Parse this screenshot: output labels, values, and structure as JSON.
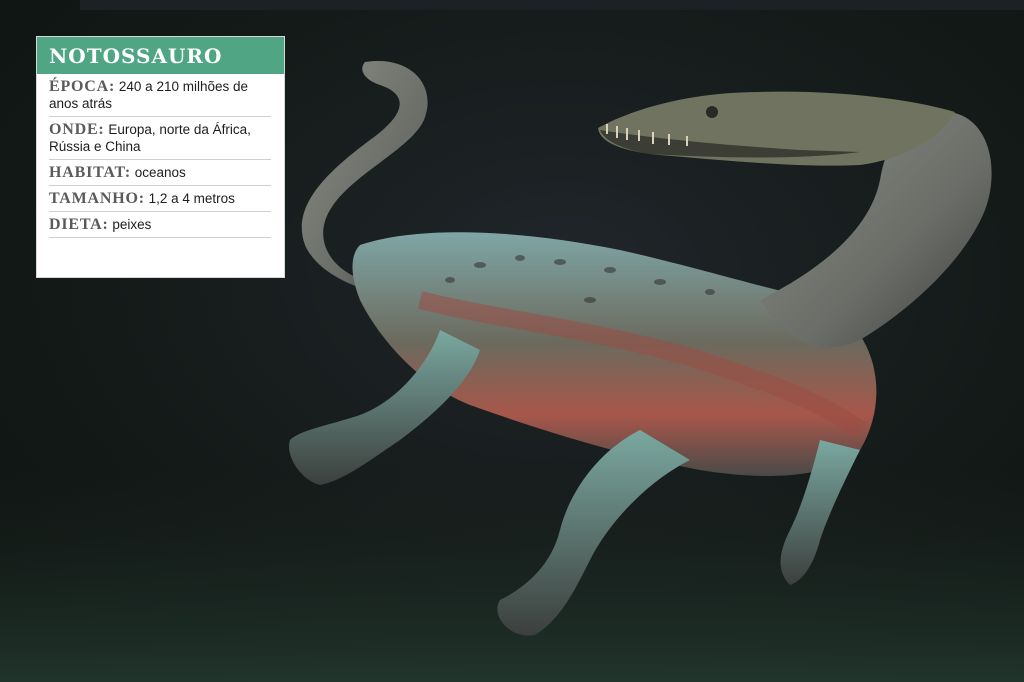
{
  "card": {
    "title": "NOTOSSAURO",
    "rows": [
      {
        "label": "ÉPOCA:",
        "value": "240 a 210 milhões de anos atrás"
      },
      {
        "label": "ONDE:",
        "value": "Europa, norte da África, Rússia e China"
      },
      {
        "label": "HABITAT:",
        "value": "oceanos"
      },
      {
        "label": "TAMANHO:",
        "value": "1,2 a 4 metros"
      },
      {
        "label": "DIETA:",
        "value": "peixes"
      }
    ]
  },
  "colors": {
    "header": "#4fa584",
    "background": "#141816"
  }
}
